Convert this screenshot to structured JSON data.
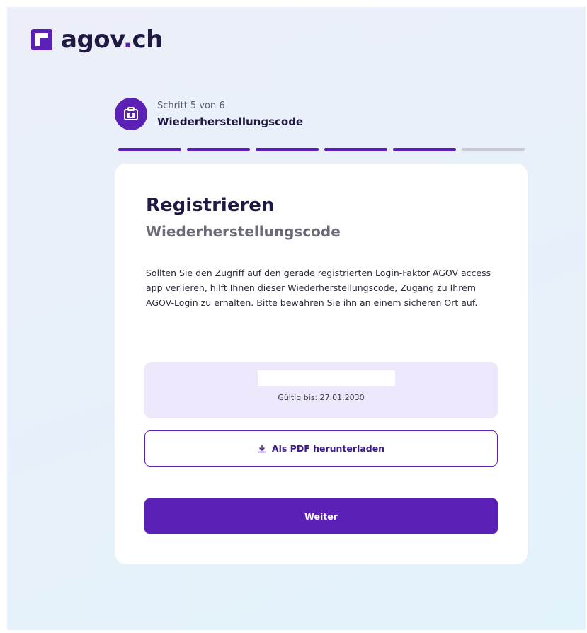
{
  "brand": {
    "name_main": "agov",
    "name_dot": ".",
    "name_tld": "ch",
    "accent_color": "#5b21b6"
  },
  "stepper": {
    "counter": "Schritt 5 von 6",
    "current_step": "Wiederherstellungscode",
    "icon": "medical-kit-icon",
    "total_steps": 6,
    "completed_steps": 5
  },
  "card": {
    "title": "Registrieren",
    "subtitle": "Wiederherstellungscode",
    "description": "Sollten Sie den Zugriff auf den gerade registrierten Login-Faktor AGOV access app verlieren, hilft Ihnen dieser Wiederherstellungscode, Zugang zu Ihrem AGOV-Login zu erhalten. Bitte bewahren Sie ihn an einem sicheren Ort auf.",
    "code_valid_until": "Gültig bis: 27.01.2030",
    "download_label": "Als PDF herunterladen",
    "download_icon": "download-icon",
    "next_label": "Weiter"
  }
}
